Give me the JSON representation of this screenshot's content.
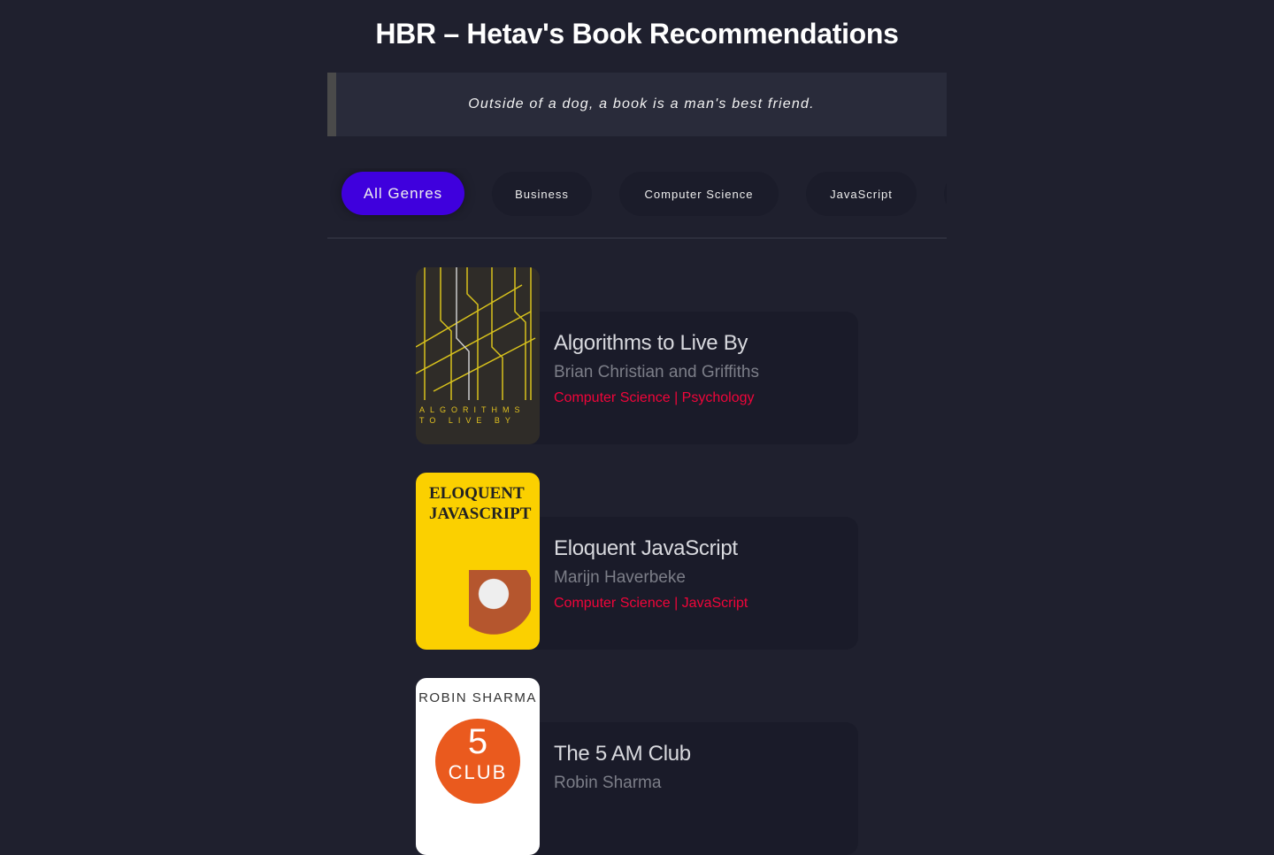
{
  "header": {
    "title": "HBR – Hetav's Book Recommendations"
  },
  "quote": "Outside of a dog, a book is a man's best friend.",
  "genres": [
    {
      "label": "All Genres",
      "active": true
    },
    {
      "label": "Business",
      "active": false
    },
    {
      "label": "Computer Science",
      "active": false
    },
    {
      "label": "JavaScript",
      "active": false
    }
  ],
  "colors": {
    "background": "#1f202e",
    "accent": "#3f00dd",
    "genre_text": "#f0053a"
  },
  "books": [
    {
      "title": "Algorithms to Live By",
      "author": "Brian Christian and Griffiths",
      "genres": "Computer Science | Psychology",
      "cover_text": "ALGORITHMS TO LIVE BY"
    },
    {
      "title": "Eloquent JavaScript",
      "author": "Marijn Haverbeke",
      "genres": "Computer Science | JavaScript",
      "cover_text": "ELOQUENT JAVASCRIPT"
    },
    {
      "title": "The 5 AM Club",
      "author": "Robin Sharma",
      "genres": "",
      "cover_text": "ROBIN SHARMA 5 CLUB"
    }
  ]
}
